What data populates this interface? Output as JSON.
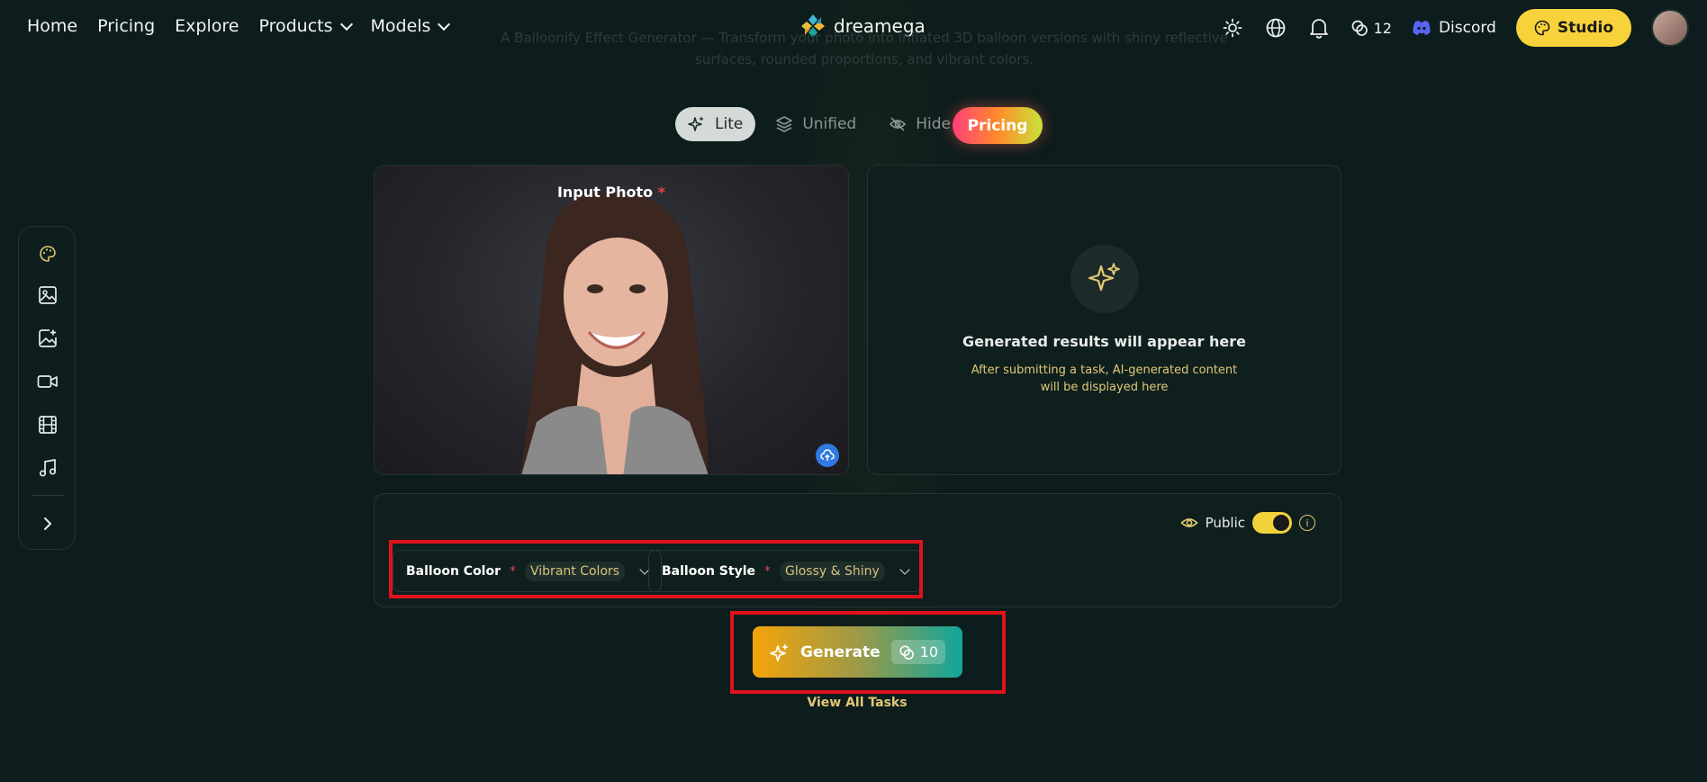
{
  "nav": {
    "links": [
      {
        "label": "Home"
      },
      {
        "label": "Pricing"
      },
      {
        "label": "Explore"
      },
      {
        "label": "Products"
      },
      {
        "label": "Models"
      }
    ],
    "brand": "dreamega",
    "credits": "12",
    "discord": "Discord",
    "studio": "Studio"
  },
  "faded_description": "A Balloonify Effect Generator — Transform your photo into inflated 3D balloon versions with shiny reflective surfaces, rounded proportions, and vibrant colors.",
  "modes": [
    {
      "label": "Lite",
      "icon": "sparkles-icon",
      "active": true
    },
    {
      "label": "Unified",
      "icon": "layers-icon",
      "active": false
    },
    {
      "label": "Hide",
      "icon": "eye-off-icon",
      "active": false
    }
  ],
  "pricing_pill": "Pricing",
  "input": {
    "label": "Input Photo",
    "required": "*"
  },
  "output": {
    "title": "Generated results will appear here",
    "subtitle": "After submitting a task, AI-generated content will be displayed here"
  },
  "options": {
    "public_label": "Public",
    "public_on": true,
    "balloon_color": {
      "label": "Balloon Color",
      "required": "*",
      "value": "Vibrant Colors"
    },
    "balloon_style": {
      "label": "Balloon Style",
      "required": "*",
      "value": "Glossy & Shiny"
    }
  },
  "generate": {
    "label": "Generate",
    "cost": "10"
  },
  "view_all_tasks": "View All Tasks",
  "colors": {
    "background": "#0d1c1c",
    "accent_yellow": "#f7d23a",
    "highlight_red": "#e0121b"
  }
}
